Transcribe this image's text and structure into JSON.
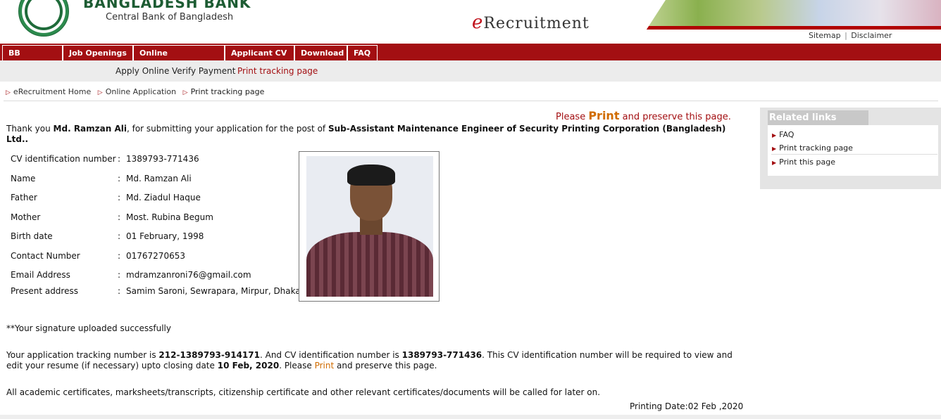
{
  "header": {
    "bank_name": "BANGLADESH BANK",
    "bank_subtitle": "Central Bank of Bangladesh",
    "app_title_prefix": "e",
    "app_title": "Recruitment",
    "sitemap": "Sitemap",
    "separator": "|",
    "disclaimer": "Disclaimer"
  },
  "nav": {
    "items": [
      "BB Website",
      "Job Openings",
      "Online Application",
      "Applicant CV",
      "Download",
      "FAQ"
    ]
  },
  "subnav": {
    "items": [
      "Apply Online",
      "Verify Payment",
      "Print tracking page"
    ],
    "active_index": 2
  },
  "breadcrumb": [
    "eRecruitment Home",
    "Online Application",
    "Print tracking page"
  ],
  "print_notice": {
    "please": "Please",
    "print": "Print",
    "rest": "and preserve this page."
  },
  "thanks": {
    "prefix": "Thank you",
    "name": "Md. Ramzan Ali",
    "middle": ", for submitting your application for the post of",
    "post": "Sub-Assistant Maintenance Engineer of Security Printing Corporation (Bangladesh) Ltd.",
    "suffix": "."
  },
  "applicant": {
    "fields": [
      {
        "label": "CV identification number",
        "value": "1389793-771436"
      },
      {
        "label": "Name",
        "value": "Md. Ramzan Ali"
      },
      {
        "label": "Father",
        "value": "Md. Ziadul Haque"
      },
      {
        "label": "Mother",
        "value": "Most. Rubina Begum"
      },
      {
        "label": "Birth date",
        "value": "01 February, 1998"
      },
      {
        "label": "Contact Number",
        "value": "01767270653"
      },
      {
        "label": "Email Address",
        "value": "mdramzanroni76@gmail.com"
      },
      {
        "label": "Present address",
        "value": "Samim Saroni, Sewrapara, Mirpur, Dhaka"
      }
    ],
    "colon": ":"
  },
  "signature_msg": "**Your signature uploaded successfully",
  "tracking": {
    "t1": "Your application tracking number is",
    "tracking_number": "212-1389793-914171",
    "t2": ". And CV identification number is",
    "cv_number": "1389793-771436",
    "t3": ". This CV identification number will be required to view and edit your resume (if necessary) upto closing date",
    "closing_date": "10 Feb, 2020",
    "t4": ". Please",
    "print": "Print",
    "t5": "and preserve this page."
  },
  "certs_note": "All academic certificates, marksheets/transcripts, citizenship certificate and other relevant certificates/documents will be called for later on.",
  "printing_date": "Printing Date:02 Feb ,2020",
  "sidebar": {
    "title": "Related links",
    "links": [
      "FAQ",
      "Print tracking page",
      "Print this page"
    ]
  },
  "colors": {
    "brand_red": "#a30f12",
    "print_orange": "#d06c00",
    "bank_green": "#1d5c33"
  }
}
